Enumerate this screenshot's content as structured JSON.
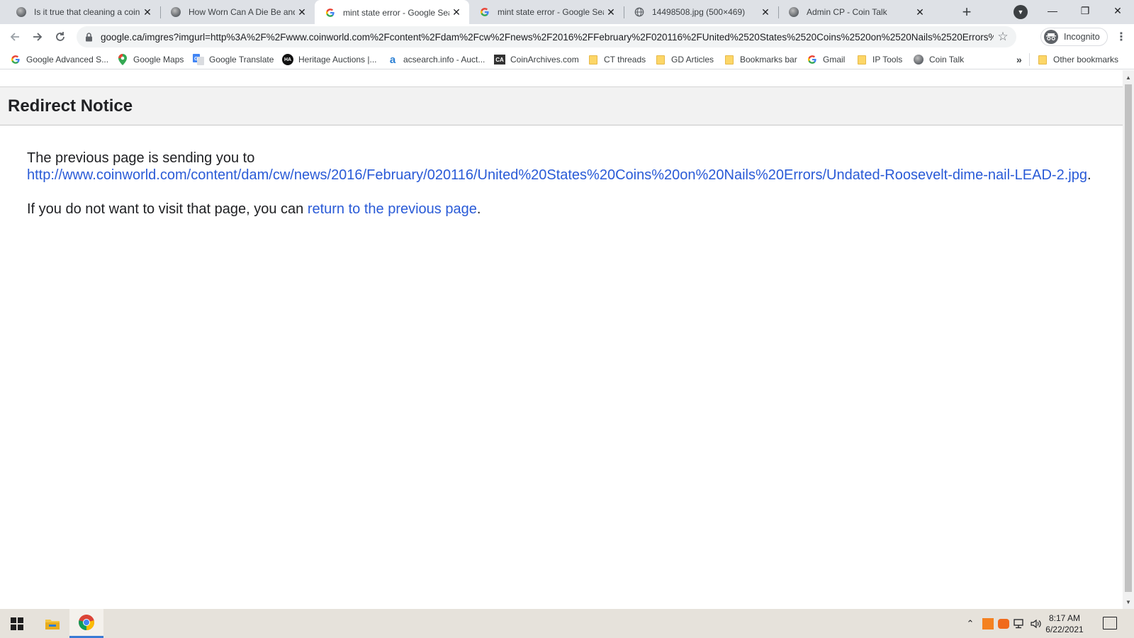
{
  "tabs": [
    {
      "title": "Is it true that cleaning a coin n",
      "favicon": "coin-talk-globe",
      "active": false
    },
    {
      "title": "How Worn Can A Die Be and S",
      "favicon": "coin-talk-globe",
      "active": false
    },
    {
      "title": "mint state error - Google Sear",
      "favicon": "google-g",
      "active": true
    },
    {
      "title": "mint state error - Google Sear",
      "favicon": "google-g",
      "active": false
    },
    {
      "title": "14498508.jpg (500×469)",
      "favicon": "globe",
      "active": false
    },
    {
      "title": "Admin CP - Coin Talk",
      "favicon": "coin-talk-globe",
      "active": false
    }
  ],
  "toolbar": {
    "url": "google.ca/imgres?imgurl=http%3A%2F%2Fwww.coinworld.com%2Fcontent%2Fdam%2Fcw%2Fnews%2F2016%2FFebruary%2F020116%2FUnited%2520States%2520Coins%2520on%2520Nails%2520Errors%...",
    "incognito_label": "Incognito"
  },
  "bookmarks": [
    {
      "label": "Google Advanced S...",
      "icon": "google-g"
    },
    {
      "label": "Google Maps",
      "icon": "maps-pin"
    },
    {
      "label": "Google Translate",
      "icon": "translate"
    },
    {
      "label": "Heritage Auctions |...",
      "icon": "ha"
    },
    {
      "label": "acsearch.info - Auct...",
      "icon": "acsearch-a"
    },
    {
      "label": "CoinArchives.com",
      "icon": "ca"
    },
    {
      "label": "CT threads",
      "icon": "folder"
    },
    {
      "label": "GD Articles",
      "icon": "folder"
    },
    {
      "label": "Bookmarks bar",
      "icon": "folder"
    },
    {
      "label": "Gmail",
      "icon": "google-g"
    },
    {
      "label": "IP Tools",
      "icon": "folder"
    },
    {
      "label": "Coin Talk",
      "icon": "coin-talk-globe"
    }
  ],
  "bookmarks_overflow": "»",
  "other_bookmarks": "Other bookmarks",
  "page": {
    "heading": "Redirect Notice",
    "line1": "The previous page is sending you to",
    "link_url": "http://www.coinworld.com/content/dam/cw/news/2016/February/020116/United%20States%20Coins%20on%20Nails%20Errors/Undated-Roosevelt-dime-nail-LEAD-2.jpg",
    "after_link": ".",
    "line2_prefix": "If you do not want to visit that page, you can ",
    "return_link": "return to the previous page",
    "line2_suffix": "."
  },
  "taskbar": {
    "time": "8:17 AM",
    "date": "6/22/2021"
  },
  "colors": {
    "link": "#2a5bd7",
    "tabstrip": "#dee1e6",
    "header_bg": "#f2f2f2",
    "taskbar": "#e6e2db"
  }
}
